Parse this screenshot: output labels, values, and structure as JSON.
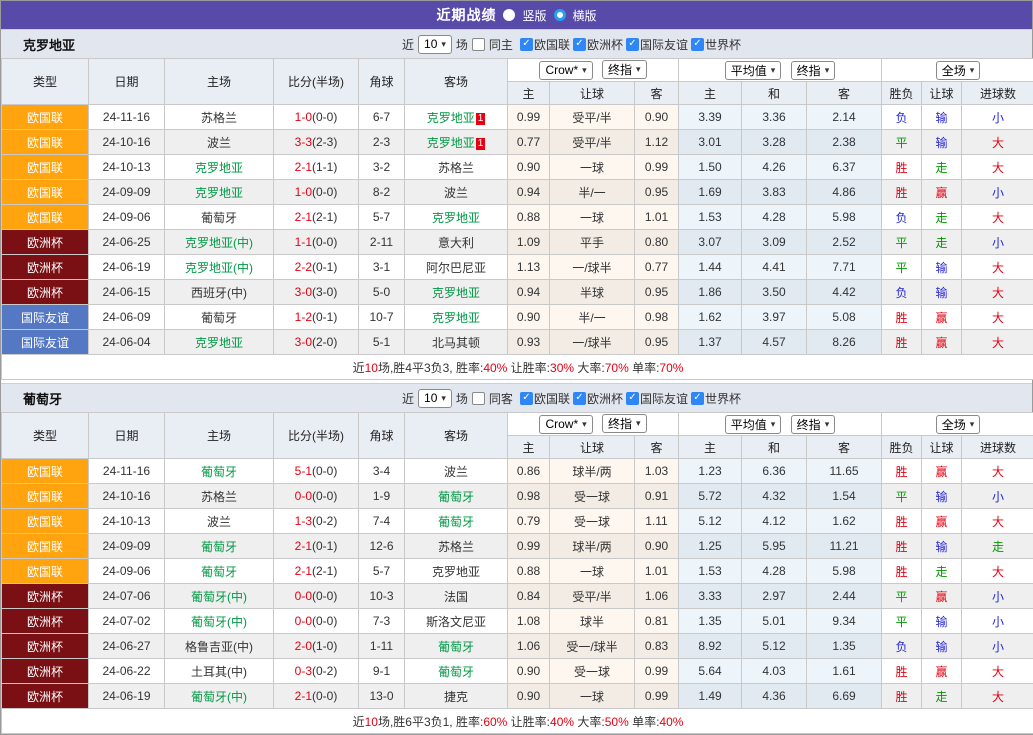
{
  "title_bar": {
    "title": "近期战绩",
    "vertical_label": "竖版",
    "horizontal_label": "横版",
    "vertical_checked": false,
    "horizontal_checked": true
  },
  "filter": {
    "near_label": "近",
    "matches_count": "10",
    "matches_label": "场",
    "leagues": [
      {
        "label": "欧国联",
        "checked": true
      },
      {
        "label": "欧洲杯",
        "checked": true
      },
      {
        "label": "国际友谊",
        "checked": true
      },
      {
        "label": "世界杯",
        "checked": true
      }
    ]
  },
  "table_header": {
    "type": "类型",
    "date": "日期",
    "home": "主场",
    "score": "比分(半场)",
    "corner": "角球",
    "away": "客场",
    "handicap_select": "Crow*",
    "handicap_select2": "终指",
    "avg_select": "平均值",
    "avg_select2": "终指",
    "result_select": "全场",
    "sub_handicap": [
      "主",
      "让球",
      "客"
    ],
    "sub_avg": [
      "主",
      "和",
      "客"
    ],
    "sub_result": [
      "胜负",
      "让球",
      "进球数"
    ]
  },
  "league_colors": {
    "欧国联": "#ffa30f",
    "欧洲杯": "#7a1014",
    "国际友谊": "#5578c5"
  },
  "result_colors": {
    "red": "#e60012",
    "green": "#009900",
    "blue": "#2727d8"
  },
  "subject_team_color": "#009944",
  "titlebar_color": "#574aa8",
  "sections": [
    {
      "team": "克罗地亚",
      "same_label": "同主",
      "rows": [
        {
          "league": "欧国联",
          "date": "24-11-16",
          "home": "苏格兰",
          "home_subject": false,
          "score_ft": "1-0",
          "score_ht": "(0-0)",
          "corner": "6-7",
          "away": "克罗地亚",
          "away_subject": true,
          "away_badge": "1",
          "h_home": "0.99",
          "h_line": "受平/半",
          "h_away": "0.90",
          "avg_home": "3.39",
          "avg_draw": "3.36",
          "avg_away": "2.14",
          "res_wdl": "负",
          "res_wdl_color": "blue",
          "res_let": "输",
          "res_let_color": "blue",
          "res_goal": "小",
          "res_goal_color": "blue"
        },
        {
          "league": "欧国联",
          "date": "24-10-16",
          "home": "波兰",
          "home_subject": false,
          "score_ft": "3-3",
          "score_ht": "(2-3)",
          "corner": "2-3",
          "away": "克罗地亚",
          "away_subject": true,
          "away_badge": "1",
          "h_home": "0.77",
          "h_line": "受平/半",
          "h_away": "1.12",
          "avg_home": "3.01",
          "avg_draw": "3.28",
          "avg_away": "2.38",
          "res_wdl": "平",
          "res_wdl_color": "green",
          "res_let": "输",
          "res_let_color": "blue",
          "res_goal": "大",
          "res_goal_color": "red"
        },
        {
          "league": "欧国联",
          "date": "24-10-13",
          "home": "克罗地亚",
          "home_subject": true,
          "score_ft": "2-1",
          "score_ht": "(1-1)",
          "corner": "3-2",
          "away": "苏格兰",
          "away_subject": false,
          "h_home": "0.90",
          "h_line": "一球",
          "h_away": "0.99",
          "avg_home": "1.50",
          "avg_draw": "4.26",
          "avg_away": "6.37",
          "res_wdl": "胜",
          "res_wdl_color": "red",
          "res_let": "走",
          "res_let_color": "green",
          "res_goal": "大",
          "res_goal_color": "red"
        },
        {
          "league": "欧国联",
          "date": "24-09-09",
          "home": "克罗地亚",
          "home_subject": true,
          "score_ft": "1-0",
          "score_ht": "(0-0)",
          "corner": "8-2",
          "away": "波兰",
          "away_subject": false,
          "h_home": "0.94",
          "h_line": "半/一",
          "h_away": "0.95",
          "avg_home": "1.69",
          "avg_draw": "3.83",
          "avg_away": "4.86",
          "res_wdl": "胜",
          "res_wdl_color": "red",
          "res_let": "赢",
          "res_let_color": "red",
          "res_goal": "小",
          "res_goal_color": "blue"
        },
        {
          "league": "欧国联",
          "date": "24-09-06",
          "home": "葡萄牙",
          "home_subject": false,
          "score_ft": "2-1",
          "score_ht": "(2-1)",
          "corner": "5-7",
          "away": "克罗地亚",
          "away_subject": true,
          "h_home": "0.88",
          "h_line": "一球",
          "h_away": "1.01",
          "avg_home": "1.53",
          "avg_draw": "4.28",
          "avg_away": "5.98",
          "res_wdl": "负",
          "res_wdl_color": "blue",
          "res_let": "走",
          "res_let_color": "green",
          "res_goal": "大",
          "res_goal_color": "red"
        },
        {
          "league": "欧洲杯",
          "date": "24-06-25",
          "home": "克罗地亚(中)",
          "home_subject": true,
          "score_ft": "1-1",
          "score_ht": "(0-0)",
          "corner": "2-11",
          "away": "意大利",
          "away_subject": false,
          "h_home": "1.09",
          "h_line": "平手",
          "h_away": "0.80",
          "avg_home": "3.07",
          "avg_draw": "3.09",
          "avg_away": "2.52",
          "res_wdl": "平",
          "res_wdl_color": "green",
          "res_let": "走",
          "res_let_color": "green",
          "res_goal": "小",
          "res_goal_color": "blue"
        },
        {
          "league": "欧洲杯",
          "date": "24-06-19",
          "home": "克罗地亚(中)",
          "home_subject": true,
          "score_ft": "2-2",
          "score_ht": "(0-1)",
          "corner": "3-1",
          "away": "阿尔巴尼亚",
          "away_subject": false,
          "h_home": "1.13",
          "h_line": "一/球半",
          "h_away": "0.77",
          "avg_home": "1.44",
          "avg_draw": "4.41",
          "avg_away": "7.71",
          "res_wdl": "平",
          "res_wdl_color": "green",
          "res_let": "输",
          "res_let_color": "blue",
          "res_goal": "大",
          "res_goal_color": "red"
        },
        {
          "league": "欧洲杯",
          "date": "24-06-15",
          "home": "西班牙(中)",
          "home_subject": false,
          "score_ft": "3-0",
          "score_ht": "(3-0)",
          "corner": "5-0",
          "away": "克罗地亚",
          "away_subject": true,
          "h_home": "0.94",
          "h_line": "半球",
          "h_away": "0.95",
          "avg_home": "1.86",
          "avg_draw": "3.50",
          "avg_away": "4.42",
          "res_wdl": "负",
          "res_wdl_color": "blue",
          "res_let": "输",
          "res_let_color": "blue",
          "res_goal": "大",
          "res_goal_color": "red"
        },
        {
          "league": "国际友谊",
          "date": "24-06-09",
          "home": "葡萄牙",
          "home_subject": false,
          "score_ft": "1-2",
          "score_ht": "(0-1)",
          "corner": "10-7",
          "away": "克罗地亚",
          "away_subject": true,
          "h_home": "0.90",
          "h_line": "半/一",
          "h_away": "0.98",
          "avg_home": "1.62",
          "avg_draw": "3.97",
          "avg_away": "5.08",
          "res_wdl": "胜",
          "res_wdl_color": "red",
          "res_let": "赢",
          "res_let_color": "red",
          "res_goal": "大",
          "res_goal_color": "red"
        },
        {
          "league": "国际友谊",
          "date": "24-06-04",
          "home": "克罗地亚",
          "home_subject": true,
          "score_ft": "3-0",
          "score_ht": "(2-0)",
          "corner": "5-1",
          "away": "北马其顿",
          "away_subject": false,
          "h_home": "0.93",
          "h_line": "一/球半",
          "h_away": "0.95",
          "avg_home": "1.37",
          "avg_draw": "4.57",
          "avg_away": "8.26",
          "res_wdl": "胜",
          "res_wdl_color": "red",
          "res_let": "赢",
          "res_let_color": "red",
          "res_goal": "大",
          "res_goal_color": "red"
        }
      ],
      "summary_segments": [
        {
          "text": "近",
          "color": "dark"
        },
        {
          "text": "10",
          "color": "red"
        },
        {
          "text": "场,胜4平3负3, 胜率:",
          "color": "dark"
        },
        {
          "text": "40%",
          "color": "red"
        },
        {
          "text": " 让胜率:",
          "color": "dark"
        },
        {
          "text": "30%",
          "color": "red"
        },
        {
          "text": " 大率:",
          "color": "dark"
        },
        {
          "text": "70%",
          "color": "red"
        },
        {
          "text": " 单率:",
          "color": "dark"
        },
        {
          "text": "70%",
          "color": "red"
        }
      ]
    },
    {
      "team": "葡萄牙",
      "same_label": "同客",
      "rows": [
        {
          "league": "欧国联",
          "date": "24-11-16",
          "home": "葡萄牙",
          "home_subject": true,
          "score_ft": "5-1",
          "score_ht": "(0-0)",
          "corner": "3-4",
          "away": "波兰",
          "away_subject": false,
          "h_home": "0.86",
          "h_line": "球半/两",
          "h_away": "1.03",
          "avg_home": "1.23",
          "avg_draw": "6.36",
          "avg_away": "11.65",
          "res_wdl": "胜",
          "res_wdl_color": "red",
          "res_let": "赢",
          "res_let_color": "red",
          "res_goal": "大",
          "res_goal_color": "red"
        },
        {
          "league": "欧国联",
          "date": "24-10-16",
          "home": "苏格兰",
          "home_subject": false,
          "score_ft": "0-0",
          "score_ht": "(0-0)",
          "corner": "1-9",
          "away": "葡萄牙",
          "away_subject": true,
          "h_home": "0.98",
          "h_line": "受一球",
          "h_away": "0.91",
          "avg_home": "5.72",
          "avg_draw": "4.32",
          "avg_away": "1.54",
          "res_wdl": "平",
          "res_wdl_color": "green",
          "res_let": "输",
          "res_let_color": "blue",
          "res_goal": "小",
          "res_goal_color": "blue"
        },
        {
          "league": "欧国联",
          "date": "24-10-13",
          "home": "波兰",
          "home_subject": false,
          "score_ft": "1-3",
          "score_ht": "(0-2)",
          "corner": "7-4",
          "away": "葡萄牙",
          "away_subject": true,
          "h_home": "0.79",
          "h_line": "受一球",
          "h_away": "1.11",
          "avg_home": "5.12",
          "avg_draw": "4.12",
          "avg_away": "1.62",
          "res_wdl": "胜",
          "res_wdl_color": "red",
          "res_let": "赢",
          "res_let_color": "red",
          "res_goal": "大",
          "res_goal_color": "red"
        },
        {
          "league": "欧国联",
          "date": "24-09-09",
          "home": "葡萄牙",
          "home_subject": true,
          "score_ft": "2-1",
          "score_ht": "(0-1)",
          "corner": "12-6",
          "away": "苏格兰",
          "away_subject": false,
          "h_home": "0.99",
          "h_line": "球半/两",
          "h_away": "0.90",
          "avg_home": "1.25",
          "avg_draw": "5.95",
          "avg_away": "11.21",
          "res_wdl": "胜",
          "res_wdl_color": "red",
          "res_let": "输",
          "res_let_color": "blue",
          "res_goal": "走",
          "res_goal_color": "green"
        },
        {
          "league": "欧国联",
          "date": "24-09-06",
          "home": "葡萄牙",
          "home_subject": true,
          "score_ft": "2-1",
          "score_ht": "(2-1)",
          "corner": "5-7",
          "away": "克罗地亚",
          "away_subject": false,
          "h_home": "0.88",
          "h_line": "一球",
          "h_away": "1.01",
          "avg_home": "1.53",
          "avg_draw": "4.28",
          "avg_away": "5.98",
          "res_wdl": "胜",
          "res_wdl_color": "red",
          "res_let": "走",
          "res_let_color": "green",
          "res_goal": "大",
          "res_goal_color": "red"
        },
        {
          "league": "欧洲杯",
          "date": "24-07-06",
          "home": "葡萄牙(中)",
          "home_subject": true,
          "score_ft": "0-0",
          "score_ht": "(0-0)",
          "corner": "10-3",
          "away": "法国",
          "away_subject": false,
          "h_home": "0.84",
          "h_line": "受平/半",
          "h_away": "1.06",
          "avg_home": "3.33",
          "avg_draw": "2.97",
          "avg_away": "2.44",
          "res_wdl": "平",
          "res_wdl_color": "green",
          "res_let": "赢",
          "res_let_color": "red",
          "res_goal": "小",
          "res_goal_color": "blue"
        },
        {
          "league": "欧洲杯",
          "date": "24-07-02",
          "home": "葡萄牙(中)",
          "home_subject": true,
          "score_ft": "0-0",
          "score_ht": "(0-0)",
          "corner": "7-3",
          "away": "斯洛文尼亚",
          "away_subject": false,
          "h_home": "1.08",
          "h_line": "球半",
          "h_away": "0.81",
          "avg_home": "1.35",
          "avg_draw": "5.01",
          "avg_away": "9.34",
          "res_wdl": "平",
          "res_wdl_color": "green",
          "res_let": "输",
          "res_let_color": "blue",
          "res_goal": "小",
          "res_goal_color": "blue"
        },
        {
          "league": "欧洲杯",
          "date": "24-06-27",
          "home": "格鲁吉亚(中)",
          "home_subject": false,
          "score_ft": "2-0",
          "score_ht": "(1-0)",
          "corner": "1-11",
          "away": "葡萄牙",
          "away_subject": true,
          "h_home": "1.06",
          "h_line": "受一/球半",
          "h_away": "0.83",
          "avg_home": "8.92",
          "avg_draw": "5.12",
          "avg_away": "1.35",
          "res_wdl": "负",
          "res_wdl_color": "blue",
          "res_let": "输",
          "res_let_color": "blue",
          "res_goal": "小",
          "res_goal_color": "blue"
        },
        {
          "league": "欧洲杯",
          "date": "24-06-22",
          "home": "土耳其(中)",
          "home_subject": false,
          "score_ft": "0-3",
          "score_ht": "(0-2)",
          "corner": "9-1",
          "away": "葡萄牙",
          "away_subject": true,
          "h_home": "0.90",
          "h_line": "受一球",
          "h_away": "0.99",
          "avg_home": "5.64",
          "avg_draw": "4.03",
          "avg_away": "1.61",
          "res_wdl": "胜",
          "res_wdl_color": "red",
          "res_let": "赢",
          "res_let_color": "red",
          "res_goal": "大",
          "res_goal_color": "red"
        },
        {
          "league": "欧洲杯",
          "date": "24-06-19",
          "home": "葡萄牙(中)",
          "home_subject": true,
          "score_ft": "2-1",
          "score_ht": "(0-0)",
          "corner": "13-0",
          "away": "捷克",
          "away_subject": false,
          "h_home": "0.90",
          "h_line": "一球",
          "h_away": "0.99",
          "avg_home": "1.49",
          "avg_draw": "4.36",
          "avg_away": "6.69",
          "res_wdl": "胜",
          "res_wdl_color": "red",
          "res_let": "走",
          "res_let_color": "green",
          "res_goal": "大",
          "res_goal_color": "red"
        }
      ],
      "summary_segments": [
        {
          "text": "近",
          "color": "dark"
        },
        {
          "text": "10",
          "color": "red"
        },
        {
          "text": "场,胜6平3负1, 胜率:",
          "color": "dark"
        },
        {
          "text": "60%",
          "color": "red"
        },
        {
          "text": " 让胜率:",
          "color": "dark"
        },
        {
          "text": "40%",
          "color": "red"
        },
        {
          "text": " 大率:",
          "color": "dark"
        },
        {
          "text": "50%",
          "color": "red"
        },
        {
          "text": " 单率:",
          "color": "dark"
        },
        {
          "text": "40%",
          "color": "red"
        }
      ]
    }
  ]
}
